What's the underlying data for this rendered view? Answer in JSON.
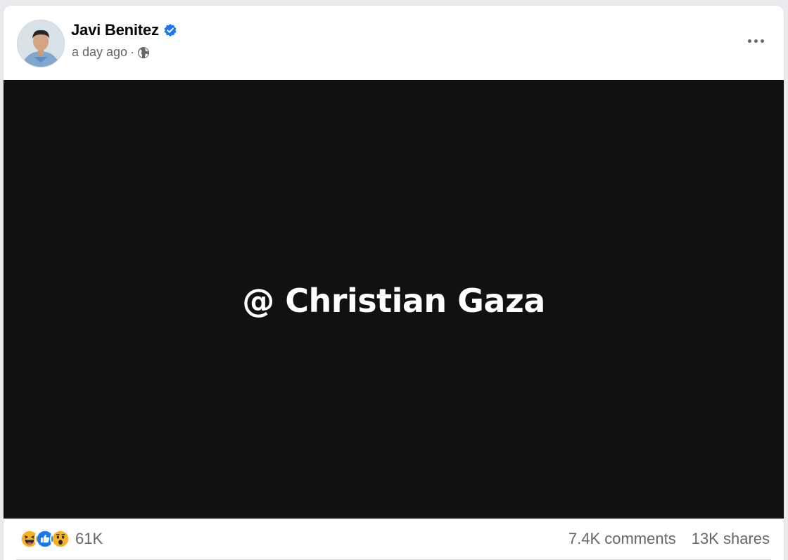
{
  "post": {
    "author": {
      "name": "Javi Benitez",
      "verified_icon": "verified-badge-icon",
      "avatar_icon": "profile-photo"
    },
    "meta": {
      "time": "a day ago",
      "separator": "·",
      "privacy_icon": "globe-icon"
    },
    "more_icon": "more-options-icon",
    "media": {
      "text": "@ Christian Gaza",
      "background": "#111111"
    },
    "reactions": {
      "icons": [
        "haha-icon",
        "like-icon",
        "wow-icon"
      ],
      "count": "61K"
    },
    "stats": {
      "comments": "7.4K comments",
      "shares": "13K shares"
    }
  },
  "colors": {
    "accent": "#1877f2",
    "secondary_text": "#65676b",
    "primary_text": "#050505"
  }
}
